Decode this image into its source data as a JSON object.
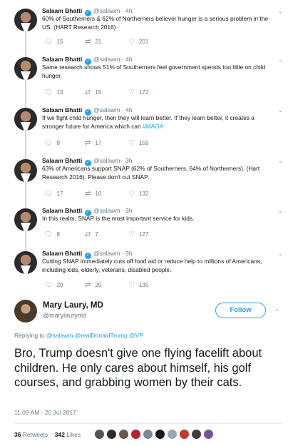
{
  "thread": [
    {
      "name": "Salaam Bhatti",
      "handle": "@salawm",
      "time": "4h",
      "text": "60% of Southerners & 62% of Northerners believer hunger is a serious problem in the US. (HART Research 2016)",
      "hashtag": "",
      "replies": "15",
      "retweets": "21",
      "likes": "201"
    },
    {
      "name": "Salaam Bhatti",
      "handle": "@salawm",
      "time": "4h",
      "text": "Same research shows 51% of Southerners feel government spends too little on child hunger.",
      "hashtag": "",
      "replies": "13",
      "retweets": "15",
      "likes": "172"
    },
    {
      "name": "Salaam Bhatti",
      "handle": "@salawm",
      "time": "4h",
      "text": "If we fight child hunger, then they will learn better. If they learn better, it creates a stronger future for America which can ",
      "hashtag": "#MAGA",
      "replies": "8",
      "retweets": "17",
      "likes": "159"
    },
    {
      "name": "Salaam Bhatti",
      "handle": "@salawm",
      "time": "3h",
      "text": "63% of Americans support SNAP (62% of Southerners, 64% of Northerners). (Hart Research 2016). Please don't cut SNAP.",
      "hashtag": "",
      "replies": "17",
      "retweets": "10",
      "likes": "132"
    },
    {
      "name": "Salaam Bhatti",
      "handle": "@salawm",
      "time": "3h",
      "text": "In this realm, SNAP is the most important service for kids.",
      "hashtag": "",
      "replies": "8",
      "retweets": "7",
      "likes": "127"
    },
    {
      "name": "Salaam Bhatti",
      "handle": "@salawm",
      "time": "3h",
      "text": "Cutting SNAP immediately cuts off food aid or reduce help to millions of Americans, including kids, elderly, veterans, disabled people.",
      "hashtag": "",
      "replies": "20",
      "retweets": "20",
      "likes": "135"
    }
  ],
  "main": {
    "name": "Mary Laury, MD",
    "handle": "@marylaurymd",
    "follow_label": "Follow",
    "replying_prefix": "Replying to",
    "replying_to": "@salawm @realDonaldTrump @VP",
    "text": "Bro, Trump doesn't give one flying facelift about children. He only cares about himself, his golf courses, and grabbing women by their cats.",
    "timestamp": "11:09 AM - 20 Jul 2017",
    "retweets_count": "36",
    "retweets_label": "Retweets",
    "likes_count": "342",
    "likes_label": "Likes"
  },
  "colors": {
    "accent": "#1da1f2",
    "text": "#14171a",
    "muted": "#657786"
  },
  "icons": {
    "reply": "reply-icon",
    "retweet": "retweet-icon",
    "like": "heart-icon",
    "verified": "verified-badge-icon",
    "more": "chevron-down-icon"
  },
  "liker_colors": [
    "#555555",
    "#2d2d2d",
    "#6b5a4a",
    "#b22234",
    "#7a8a9a",
    "#1a1a1a",
    "#9aa6b2",
    "#c0392b",
    "#3d3d3d",
    "#7b4fa0"
  ]
}
